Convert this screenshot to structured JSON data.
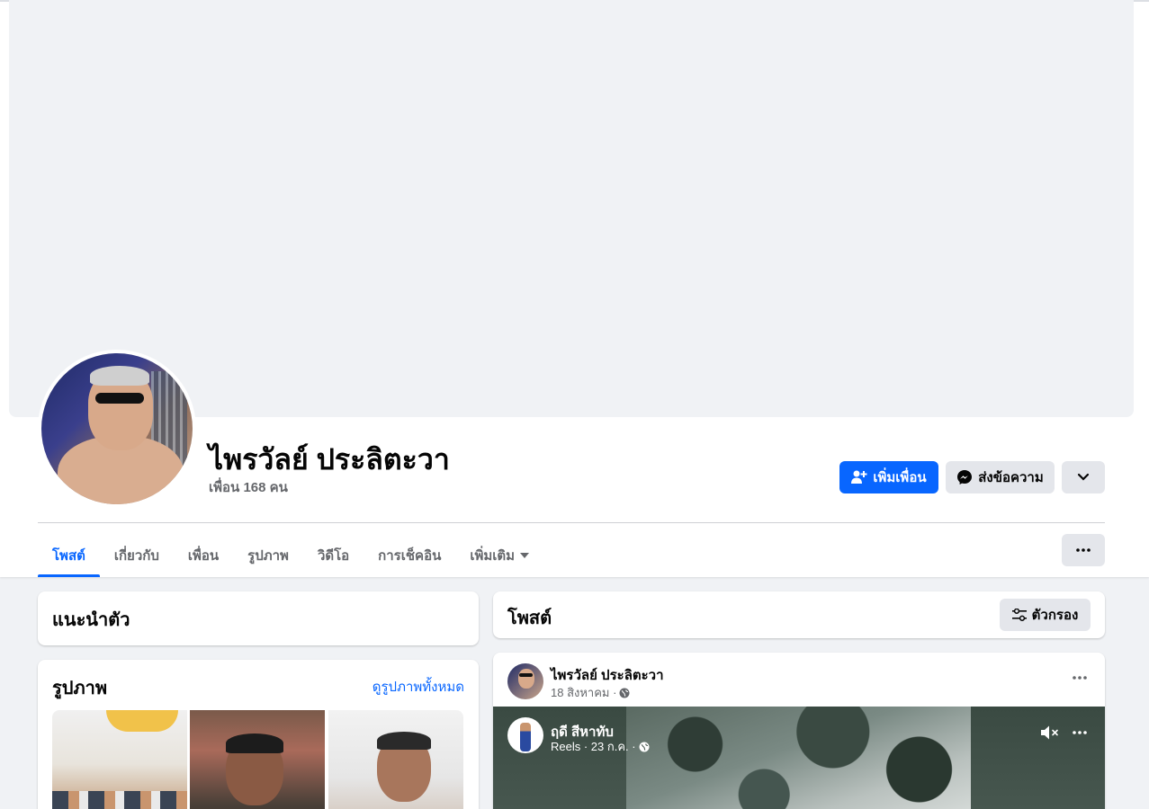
{
  "profile": {
    "name": "ไพรวัลย์ ประลิตะวา",
    "friends": "เพื่อน 168 คน"
  },
  "actions": {
    "add_friend": "เพิ่มเพื่อน",
    "message": "ส่งข้อความ"
  },
  "tabs": [
    {
      "label": "โพสต์"
    },
    {
      "label": "เกี่ยวกับ"
    },
    {
      "label": "เพื่อน"
    },
    {
      "label": "รูปภาพ"
    },
    {
      "label": "วิดีโอ"
    },
    {
      "label": "การเช็คอิน"
    },
    {
      "label": "เพิ่มเติม"
    }
  ],
  "intro": {
    "title": "แนะนำตัว"
  },
  "photos": {
    "title": "รูปภาพ",
    "see_all": "ดูรูปภาพทั้งหมด"
  },
  "posts": {
    "title": "โพสต์",
    "filter": "ตัวกรอง"
  },
  "post": {
    "author": "ไพรวัลย์ ประลิตะวา",
    "date": "18 สิงหาคม ·",
    "reel": {
      "author": "ฤดี สีหาทับ",
      "meta": "Reels · 23 ก.ค. ·"
    }
  },
  "colors": {
    "accent": "#0866ff",
    "secondary_button": "#e4e6eb",
    "background": "#f0f2f5"
  }
}
